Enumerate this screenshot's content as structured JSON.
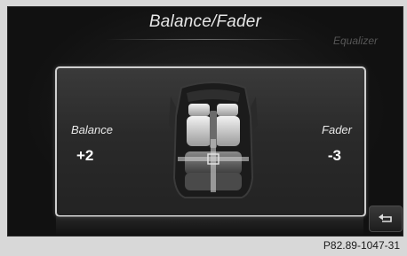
{
  "screen": {
    "title": "Balance/Fader",
    "equalizer_label": "Equalizer"
  },
  "balance": {
    "label": "Balance",
    "value": "+2"
  },
  "fader": {
    "label": "Fader",
    "value": "-3"
  },
  "icons": {
    "car": "car-seats-icon",
    "back": "back-arrow-icon"
  },
  "caption": "P82.89-1047-31"
}
